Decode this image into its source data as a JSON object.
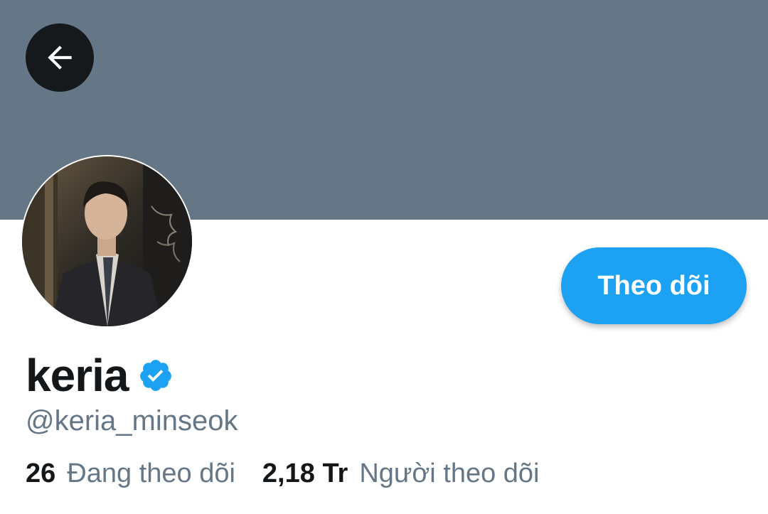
{
  "header": {
    "back_icon": "arrow-left-icon",
    "banner_color": "#657786"
  },
  "profile": {
    "avatar_icon": "profile-photo",
    "follow_label": "Theo dõi",
    "display_name": "keria",
    "verified_icon": "verified-badge-icon",
    "handle": "@keria_minseok",
    "following_count": "26",
    "following_label": "Đang theo dõi",
    "followers_count": "2,18 Tr",
    "followers_label": "Người theo dõi"
  },
  "colors": {
    "accent": "#1da1f2",
    "text_primary": "#14171a",
    "text_secondary": "#657786"
  }
}
